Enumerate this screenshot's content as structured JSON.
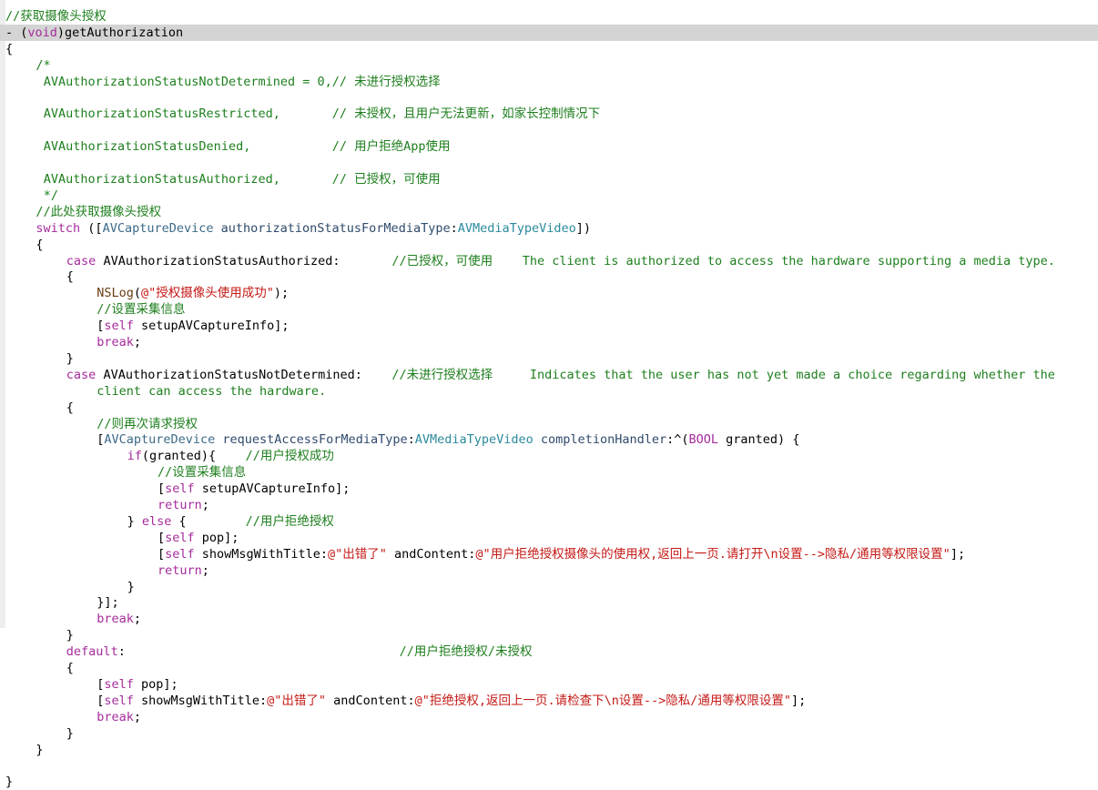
{
  "editor": {
    "language": "Objective-C",
    "colors": {
      "comment": "#1e7f1e",
      "keyword": "#a52b9b",
      "string": "#c41a16",
      "class": "#3d6a87",
      "constant": "#2c8a9c",
      "highlight": "#d4d4d4"
    },
    "lines": [
      {
        "indent": 0,
        "tokens": [
          {
            "t": "//获取摄像头授权",
            "c": "comment"
          }
        ]
      },
      {
        "indent": 0,
        "highlight": true,
        "tokens": [
          {
            "t": "- (",
            "c": "plain"
          },
          {
            "t": "void",
            "c": "kw"
          },
          {
            "t": ")getAuthorization",
            "c": "plain"
          }
        ]
      },
      {
        "indent": 0,
        "tokens": [
          {
            "t": "{",
            "c": "plain"
          }
        ]
      },
      {
        "indent": 4,
        "tokens": [
          {
            "t": "/*",
            "c": "comment"
          }
        ]
      },
      {
        "indent": 5,
        "tokens": [
          {
            "t": "AVAuthorizationStatusNotDetermined = 0,// 未进行授权选择",
            "c": "comment"
          }
        ]
      },
      {
        "indent": 0,
        "tokens": []
      },
      {
        "indent": 5,
        "tokens": [
          {
            "t": "AVAuthorizationStatusRestricted,       // 未授权，且用户无法更新，如家长控制情况下",
            "c": "comment"
          }
        ]
      },
      {
        "indent": 0,
        "tokens": []
      },
      {
        "indent": 5,
        "tokens": [
          {
            "t": "AVAuthorizationStatusDenied,           // 用户拒绝App使用",
            "c": "comment"
          }
        ]
      },
      {
        "indent": 0,
        "tokens": []
      },
      {
        "indent": 5,
        "tokens": [
          {
            "t": "AVAuthorizationStatusAuthorized,       // 已授权，可使用",
            "c": "comment"
          }
        ]
      },
      {
        "indent": 5,
        "tokens": [
          {
            "t": "*/",
            "c": "comment"
          }
        ]
      },
      {
        "indent": 4,
        "tokens": [
          {
            "t": "//此处获取摄像头授权",
            "c": "comment"
          }
        ]
      },
      {
        "indent": 4,
        "tokens": [
          {
            "t": "switch",
            "c": "kw"
          },
          {
            "t": " ([",
            "c": "plain"
          },
          {
            "t": "AVCaptureDevice",
            "c": "class"
          },
          {
            "t": " ",
            "c": "plain"
          },
          {
            "t": "authorizationStatusForMediaType",
            "c": "method"
          },
          {
            "t": ":",
            "c": "plain"
          },
          {
            "t": "AVMediaTypeVideo",
            "c": "const"
          },
          {
            "t": "])",
            "c": "plain"
          }
        ]
      },
      {
        "indent": 4,
        "tokens": [
          {
            "t": "{",
            "c": "plain"
          }
        ]
      },
      {
        "indent": 8,
        "tokens": [
          {
            "t": "case",
            "c": "kw"
          },
          {
            "t": " AVAuthorizationStatusAuthorized:       ",
            "c": "plain"
          },
          {
            "t": "//已授权，可使用    The client is authorized to access the hardware supporting a media type.",
            "c": "comment"
          }
        ]
      },
      {
        "indent": 8,
        "tokens": [
          {
            "t": "{",
            "c": "plain"
          }
        ]
      },
      {
        "indent": 12,
        "tokens": [
          {
            "t": "NSLog",
            "c": "func"
          },
          {
            "t": "(",
            "c": "plain"
          },
          {
            "t": "@\"授权摄像头使用成功\"",
            "c": "str"
          },
          {
            "t": ");",
            "c": "plain"
          }
        ]
      },
      {
        "indent": 12,
        "tokens": [
          {
            "t": "//设置采集信息",
            "c": "comment"
          }
        ]
      },
      {
        "indent": 12,
        "tokens": [
          {
            "t": "[",
            "c": "plain"
          },
          {
            "t": "self",
            "c": "kw"
          },
          {
            "t": " setupAVCaptureInfo];",
            "c": "plain"
          }
        ]
      },
      {
        "indent": 12,
        "tokens": [
          {
            "t": "break",
            "c": "kw"
          },
          {
            "t": ";",
            "c": "plain"
          }
        ]
      },
      {
        "indent": 8,
        "tokens": [
          {
            "t": "}",
            "c": "plain"
          }
        ]
      },
      {
        "indent": 8,
        "tokens": [
          {
            "t": "case",
            "c": "kw"
          },
          {
            "t": " AVAuthorizationStatusNotDetermined:    ",
            "c": "plain"
          },
          {
            "t": "//未进行授权选择     Indicates that the user has not yet made a choice regarding whether the",
            "c": "comment"
          }
        ]
      },
      {
        "indent": 12,
        "tokens": [
          {
            "t": "client can access the hardware.",
            "c": "comment"
          }
        ]
      },
      {
        "indent": 8,
        "tokens": [
          {
            "t": "{",
            "c": "plain"
          }
        ]
      },
      {
        "indent": 12,
        "tokens": [
          {
            "t": "//则再次请求授权",
            "c": "comment"
          }
        ]
      },
      {
        "indent": 12,
        "tokens": [
          {
            "t": "[",
            "c": "plain"
          },
          {
            "t": "AVCaptureDevice",
            "c": "class"
          },
          {
            "t": " ",
            "c": "plain"
          },
          {
            "t": "requestAccessForMediaType",
            "c": "method"
          },
          {
            "t": ":",
            "c": "plain"
          },
          {
            "t": "AVMediaTypeVideo",
            "c": "const"
          },
          {
            "t": " ",
            "c": "plain"
          },
          {
            "t": "completionHandler",
            "c": "method"
          },
          {
            "t": ":^(",
            "c": "plain"
          },
          {
            "t": "BOOL",
            "c": "kw"
          },
          {
            "t": " granted) {",
            "c": "plain"
          }
        ]
      },
      {
        "indent": 16,
        "tokens": [
          {
            "t": "if",
            "c": "kw"
          },
          {
            "t": "(granted){    ",
            "c": "plain"
          },
          {
            "t": "//用户授权成功",
            "c": "comment"
          }
        ]
      },
      {
        "indent": 20,
        "tokens": [
          {
            "t": "//设置采集信息",
            "c": "comment"
          }
        ]
      },
      {
        "indent": 20,
        "tokens": [
          {
            "t": "[",
            "c": "plain"
          },
          {
            "t": "self",
            "c": "kw"
          },
          {
            "t": " setupAVCaptureInfo];",
            "c": "plain"
          }
        ]
      },
      {
        "indent": 20,
        "tokens": [
          {
            "t": "return",
            "c": "kw"
          },
          {
            "t": ";",
            "c": "plain"
          }
        ]
      },
      {
        "indent": 16,
        "tokens": [
          {
            "t": "} ",
            "c": "plain"
          },
          {
            "t": "else",
            "c": "kw"
          },
          {
            "t": " {        ",
            "c": "plain"
          },
          {
            "t": "//用户拒绝授权",
            "c": "comment"
          }
        ]
      },
      {
        "indent": 20,
        "tokens": [
          {
            "t": "[",
            "c": "plain"
          },
          {
            "t": "self",
            "c": "kw"
          },
          {
            "t": " pop];",
            "c": "plain"
          }
        ]
      },
      {
        "indent": 20,
        "tokens": [
          {
            "t": "[",
            "c": "plain"
          },
          {
            "t": "self",
            "c": "kw"
          },
          {
            "t": " showMsgWithTitle:",
            "c": "plain"
          },
          {
            "t": "@\"出错了\"",
            "c": "str"
          },
          {
            "t": " andContent:",
            "c": "plain"
          },
          {
            "t": "@\"用户拒绝授权摄像头的使用权,返回上一页.请打开\\n设置-->隐私/通用等权限设置\"",
            "c": "str"
          },
          {
            "t": "];",
            "c": "plain"
          }
        ]
      },
      {
        "indent": 20,
        "tokens": [
          {
            "t": "return",
            "c": "kw"
          },
          {
            "t": ";",
            "c": "plain"
          }
        ]
      },
      {
        "indent": 16,
        "tokens": [
          {
            "t": "}",
            "c": "plain"
          }
        ]
      },
      {
        "indent": 12,
        "tokens": [
          {
            "t": "}];",
            "c": "plain"
          }
        ]
      },
      {
        "indent": 12,
        "tokens": [
          {
            "t": "break",
            "c": "kw"
          },
          {
            "t": ";",
            "c": "plain"
          }
        ]
      },
      {
        "indent": 8,
        "tokens": [
          {
            "t": "}",
            "c": "plain"
          }
        ]
      },
      {
        "indent": 8,
        "tokens": [
          {
            "t": "default",
            "c": "kw"
          },
          {
            "t": ":                                     ",
            "c": "plain"
          },
          {
            "t": "//用户拒绝授权/未授权",
            "c": "comment"
          }
        ]
      },
      {
        "indent": 8,
        "tokens": [
          {
            "t": "{",
            "c": "plain"
          }
        ]
      },
      {
        "indent": 12,
        "tokens": [
          {
            "t": "[",
            "c": "plain"
          },
          {
            "t": "self",
            "c": "kw"
          },
          {
            "t": " pop];",
            "c": "plain"
          }
        ]
      },
      {
        "indent": 12,
        "tokens": [
          {
            "t": "[",
            "c": "plain"
          },
          {
            "t": "self",
            "c": "kw"
          },
          {
            "t": " showMsgWithTitle:",
            "c": "plain"
          },
          {
            "t": "@\"出错了\"",
            "c": "str"
          },
          {
            "t": " andContent:",
            "c": "plain"
          },
          {
            "t": "@\"拒绝授权,返回上一页.请检查下\\n设置-->隐私/通用等权限设置\"",
            "c": "str"
          },
          {
            "t": "];",
            "c": "plain"
          }
        ]
      },
      {
        "indent": 12,
        "tokens": [
          {
            "t": "break",
            "c": "kw"
          },
          {
            "t": ";",
            "c": "plain"
          }
        ]
      },
      {
        "indent": 8,
        "tokens": [
          {
            "t": "}",
            "c": "plain"
          }
        ]
      },
      {
        "indent": 4,
        "tokens": [
          {
            "t": "}",
            "c": "plain"
          }
        ]
      },
      {
        "indent": 0,
        "tokens": []
      },
      {
        "indent": 0,
        "tokens": [
          {
            "t": "}",
            "c": "plain"
          }
        ]
      }
    ]
  }
}
